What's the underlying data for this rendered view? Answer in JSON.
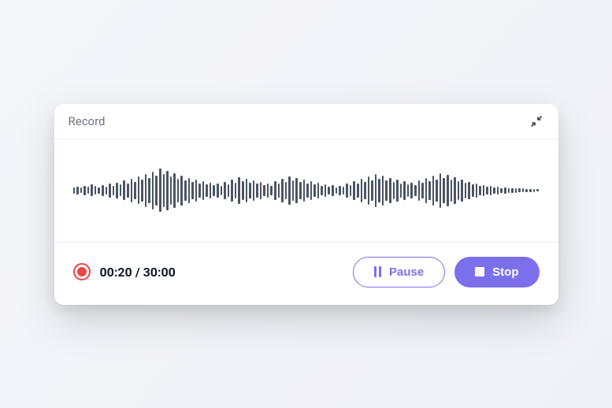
{
  "header": {
    "title": "Record"
  },
  "status": {
    "elapsed": "00:20",
    "separator": " / ",
    "total": "30:00"
  },
  "buttons": {
    "pause_label": "Pause",
    "stop_label": "Stop"
  },
  "colors": {
    "accent": "#7c6fec",
    "record": "#ef4444"
  },
  "waveform": {
    "heights": [
      8,
      10,
      7,
      12,
      9,
      15,
      11,
      8,
      14,
      10,
      18,
      12,
      20,
      15,
      25,
      18,
      30,
      22,
      35,
      28,
      42,
      32,
      48,
      38,
      55,
      42,
      50,
      36,
      44,
      30,
      38,
      26,
      32,
      22,
      28,
      18,
      24,
      16,
      20,
      14,
      18,
      12,
      22,
      16,
      28,
      20,
      34,
      24,
      30,
      20,
      26,
      18,
      22,
      14,
      18,
      12,
      24,
      18,
      30,
      22,
      36,
      26,
      32,
      22,
      28,
      18,
      24,
      16,
      20,
      12,
      16,
      10,
      14,
      8,
      12,
      10,
      18,
      14,
      24,
      18,
      30,
      22,
      36,
      26,
      42,
      30,
      38,
      26,
      32,
      22,
      28,
      18,
      24,
      16,
      20,
      14,
      26,
      20,
      32,
      24,
      38,
      28,
      44,
      32,
      40,
      28,
      34,
      24,
      28,
      20,
      22,
      16,
      18,
      12,
      14,
      10,
      12,
      8,
      10,
      6,
      8,
      6,
      6,
      6,
      5,
      5,
      4,
      4,
      4,
      3
    ]
  }
}
